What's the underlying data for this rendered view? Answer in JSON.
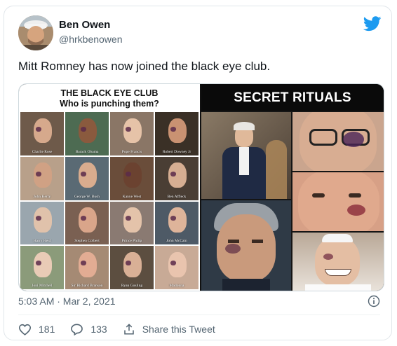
{
  "tweet": {
    "author_name": "Ben Owen",
    "author_handle": "@hrkbenowen",
    "text": "Mitt Romney has now joined the black eye club.",
    "timestamp": "5:03 AM · Mar 2, 2021",
    "likes": "181",
    "replies": "133",
    "share_label": "Share this Tweet",
    "brand_color": "#1d9bf0"
  },
  "media": {
    "left_title_line1": "THE BLACK EYE CLUB",
    "left_title_line2": "Who is punching them?",
    "right_title": "SECRET RITUALS",
    "grid_captions": [
      "Charlie Rose",
      "Barack Obama",
      "Pope Francis",
      "Robert Downey Jr",
      "John Kerry",
      "George W. Bush",
      "Kanye West",
      "Ben Affleck",
      "Harry Reid",
      "Stephen Colbert",
      "Prince Philip",
      "John McCain",
      "Joni Mitchell",
      "Sir Richard Branson",
      "Ryan Gosling",
      "Madonna"
    ]
  }
}
